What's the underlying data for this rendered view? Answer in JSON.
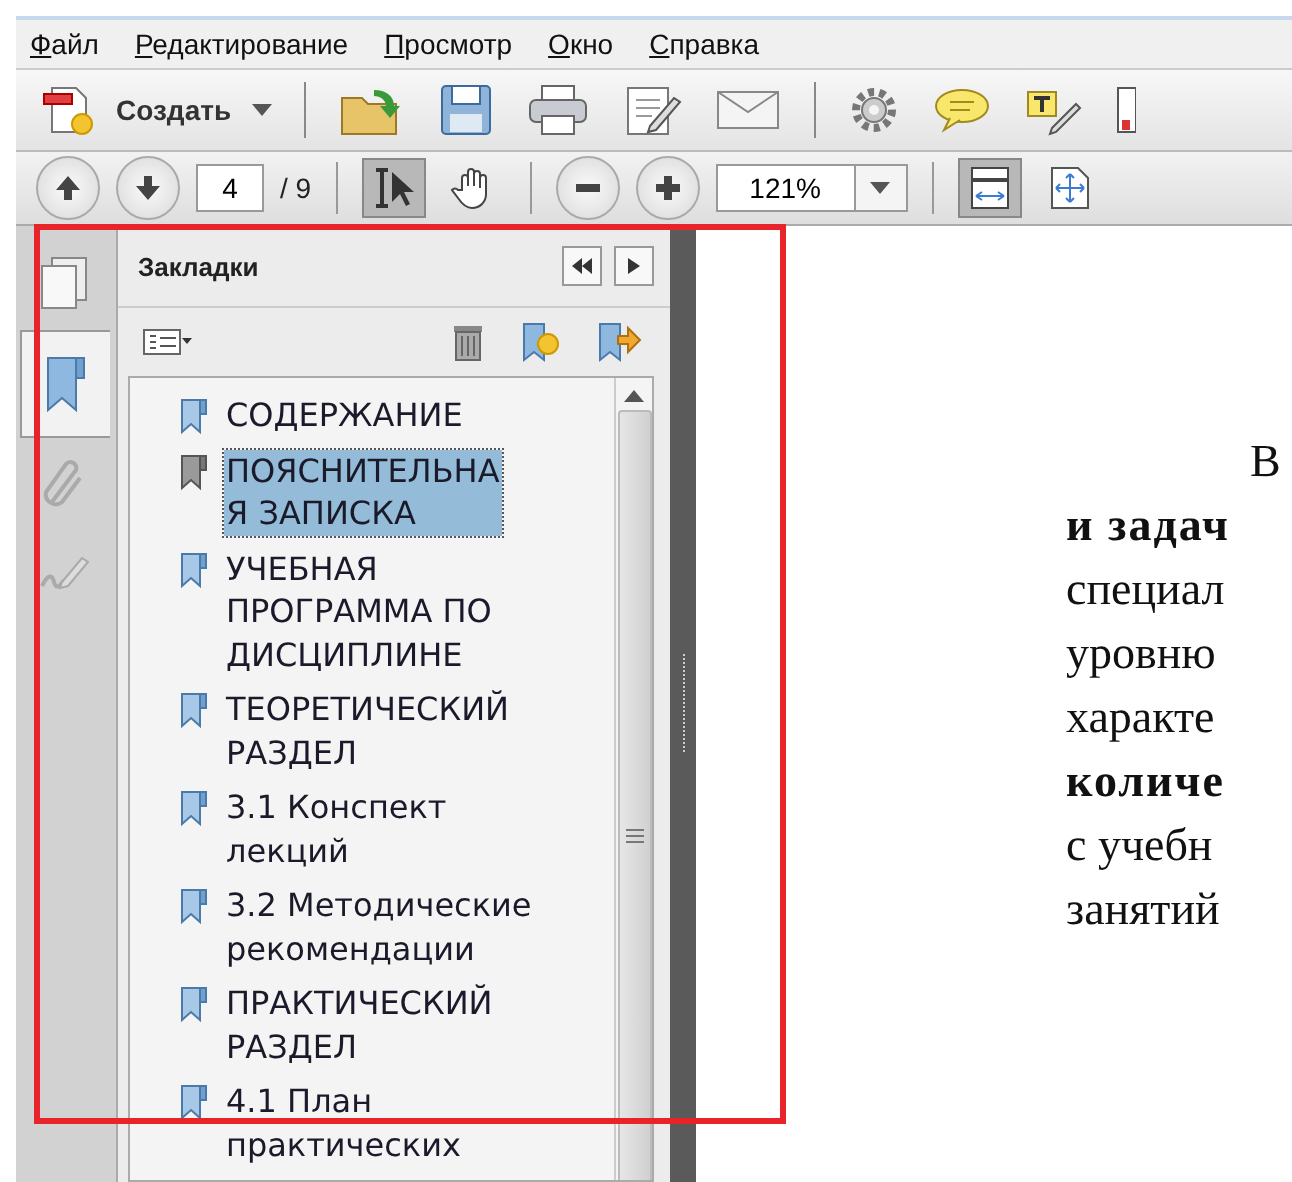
{
  "menu": [
    "Файл",
    "Редактирование",
    "Просмотр",
    "Окно",
    "Справка"
  ],
  "toolbar": {
    "create_label": "Создать"
  },
  "navigation": {
    "page": "4",
    "total": "/ 9",
    "zoom": "121%"
  },
  "tools": [
    {
      "kind": "select",
      "pressed": true
    },
    {
      "kind": "hand",
      "pressed": false
    }
  ],
  "view_buttons": [
    {
      "kind": "fit-width",
      "pressed": true
    },
    {
      "kind": "fit-page",
      "pressed": false
    }
  ],
  "nav_tabs": [
    {
      "kind": "pages",
      "selected": false
    },
    {
      "kind": "bookmarks",
      "selected": true
    },
    {
      "kind": "attachments",
      "selected": false
    },
    {
      "kind": "signatures",
      "selected": false
    }
  ],
  "bookmarks_panel": {
    "title": "Закладки",
    "items": [
      {
        "lines": [
          "СОДЕРЖАНИЕ"
        ],
        "selected": false
      },
      {
        "lines": [
          "ПОЯСНИТЕЛЬНА",
          "Я ЗАПИСКА"
        ],
        "selected": true
      },
      {
        "lines": [
          "УЧЕБНАЯ",
          "ПРОГРАММА ПО",
          "ДИСЦИПЛИНЕ"
        ],
        "selected": false
      },
      {
        "lines": [
          "ТЕОРЕТИЧЕСКИЙ",
          "РАЗДЕЛ"
        ],
        "selected": false
      },
      {
        "lines": [
          "3.1 Конспект",
          "лекций"
        ],
        "selected": false
      },
      {
        "lines": [
          "3.2 Методические",
          "рекомендации"
        ],
        "selected": false
      },
      {
        "lines": [
          "ПРАКТИЧЕСКИЙ",
          "РАЗДЕЛ"
        ],
        "selected": false
      },
      {
        "lines": [
          "4.1 План",
          "практических"
        ],
        "selected": false
      }
    ]
  },
  "document": {
    "lines": [
      {
        "kind": "paragraph-start",
        "text": "В",
        "bold": false
      },
      {
        "kind": "line",
        "text": "и задач",
        "bold": true
      },
      {
        "kind": "line",
        "text": "специал",
        "bold": false
      },
      {
        "kind": "line",
        "text": "уровню",
        "bold": false
      },
      {
        "kind": "line",
        "text": "характе",
        "bold": false
      },
      {
        "kind": "line",
        "text": "количе",
        "bold": true
      },
      {
        "kind": "line",
        "text": "с учебн",
        "bold": false
      },
      {
        "kind": "line",
        "text": "занятий",
        "bold": false
      }
    ]
  }
}
